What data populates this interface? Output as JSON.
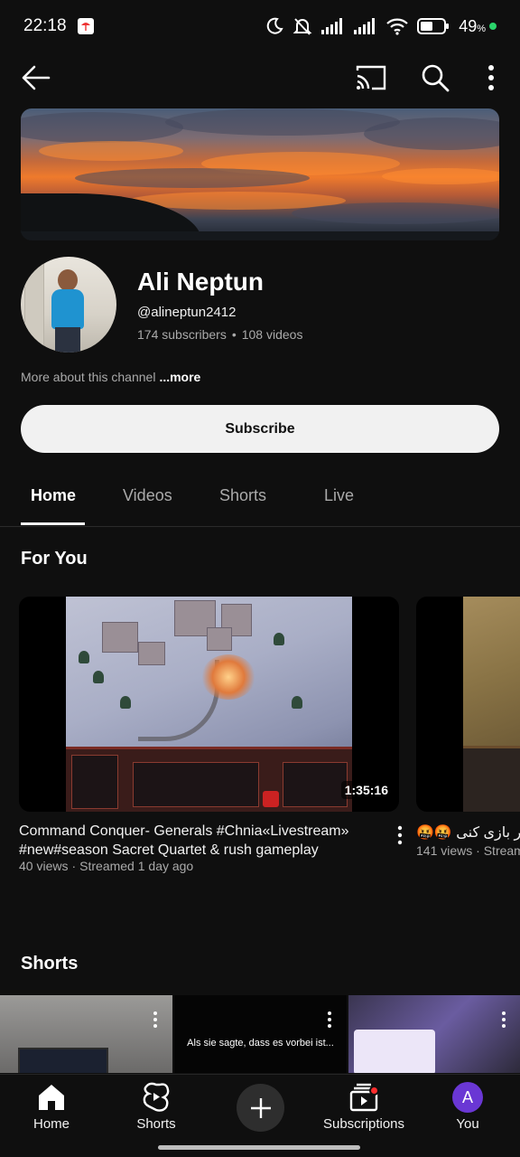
{
  "status_bar": {
    "time": "22:18",
    "battery_percent": "49",
    "battery_unit": "%",
    "icons": [
      "notification-app-icon",
      "moon-icon",
      "mute-bell-icon",
      "signal-icon",
      "signal-icon",
      "wifi-icon",
      "battery-icon"
    ]
  },
  "app_bar": {
    "icons": [
      "back-arrow-icon",
      "cast-icon",
      "search-icon",
      "more-vert-icon"
    ]
  },
  "channel": {
    "name": "Ali Neptun",
    "handle": "@alineptun2412",
    "subscribers": "174 subscribers",
    "separator": "•",
    "videos": "108 videos",
    "about_text": "More about this channel",
    "about_more": "...more",
    "subscribe_label": "Subscribe"
  },
  "tabs": [
    {
      "label": "Home",
      "active": true
    },
    {
      "label": "Videos",
      "active": false
    },
    {
      "label": "Shorts",
      "active": false
    },
    {
      "label": "Live",
      "active": false
    }
  ],
  "sections": {
    "for_you_title": "For You",
    "shorts_title": "Shorts"
  },
  "videos": [
    {
      "title": "Command Conquer- Generals  #Chnia«Livestream» #new#season Sacret Quartet & rush gameplay",
      "views": "40 views",
      "dot": "·",
      "streamed": "Streamed 1 day ago",
      "duration": "1:35:16"
    },
    {
      "title": "🤬🤬 خر بازی کنی",
      "views": "141 views",
      "dot": "·",
      "streamed": "Stream"
    }
  ],
  "shorts": [
    {
      "caption": ""
    },
    {
      "caption": "Als sie sagte, dass es vorbei ist..."
    },
    {
      "caption": ""
    }
  ],
  "bottom_nav": {
    "items": [
      {
        "label": "Home",
        "icon": "home-icon"
      },
      {
        "label": "Shorts",
        "icon": "shorts-icon"
      },
      {
        "label": "",
        "icon": "create-plus-icon"
      },
      {
        "label": "Subscriptions",
        "icon": "subscriptions-icon"
      },
      {
        "label": "You",
        "icon": "account-avatar-icon"
      }
    ],
    "you_initial": "A"
  },
  "colors": {
    "background": "#0f0f0f",
    "text_primary": "#f1f1f1",
    "text_secondary": "#aaaaaa",
    "subscribe_bg": "#f1f1f1",
    "avatar_purple": "#6a37d4",
    "badge_red": "#ff2d2d",
    "battery_dot": "#2ad46b"
  }
}
